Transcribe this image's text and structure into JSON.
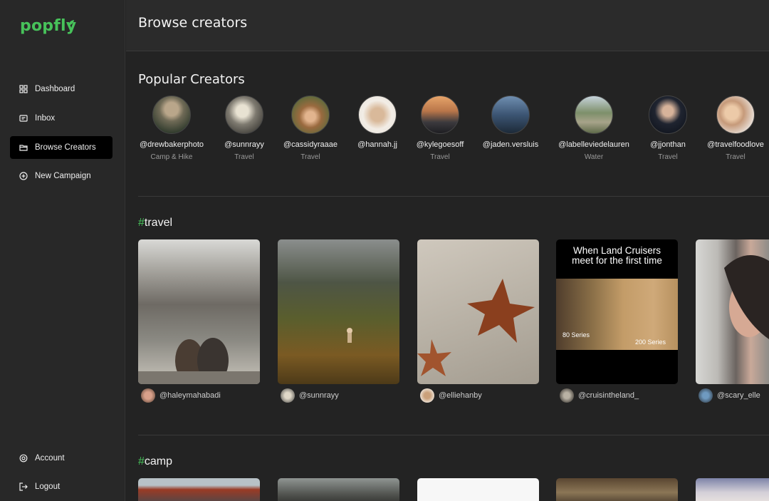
{
  "app": {
    "logo": "popfly",
    "brand_color": "#47c25a"
  },
  "sidebar": {
    "items": [
      {
        "label": "Dashboard",
        "icon": "grid-icon"
      },
      {
        "label": "Inbox",
        "icon": "inbox-icon"
      },
      {
        "label": "Browse Creators",
        "icon": "folder-icon",
        "active": true
      },
      {
        "label": "New Campaign",
        "icon": "plus-circle-icon"
      }
    ],
    "bottom": [
      {
        "label": "Account",
        "icon": "settings-icon"
      },
      {
        "label": "Logout",
        "icon": "logout-icon"
      }
    ]
  },
  "header": {
    "title": "Browse creators"
  },
  "popular": {
    "title": "Popular Creators",
    "creators": [
      {
        "handle": "@drewbakerphoto",
        "category": "Camp & Hike"
      },
      {
        "handle": "@sunnrayy",
        "category": "Travel"
      },
      {
        "handle": "@cassidyraaae",
        "category": "Travel"
      },
      {
        "handle": "@hannah.jj",
        "category": ""
      },
      {
        "handle": "@kylegoesoff",
        "category": "Travel"
      },
      {
        "handle": "@jaden.versluis",
        "category": ""
      },
      {
        "handle": "@labelleviedelauren",
        "category": "Water"
      },
      {
        "handle": "@jjonthan",
        "category": "Travel"
      },
      {
        "handle": "@travelfoodlove",
        "category": "Travel"
      }
    ]
  },
  "travel": {
    "hash": "#",
    "name": "travel",
    "cards": [
      {
        "user": "@haleymahabadi"
      },
      {
        "user": "@sunnrayy"
      },
      {
        "user": "@elliehanby"
      },
      {
        "user": "@cruisintheland_",
        "meme_title": "When Land Cruisers meet for the first time",
        "caption_left": "80 Series",
        "caption_right": "200 Series"
      },
      {
        "user": "@scary_elle"
      }
    ]
  },
  "camp": {
    "hash": "#",
    "name": "camp"
  }
}
